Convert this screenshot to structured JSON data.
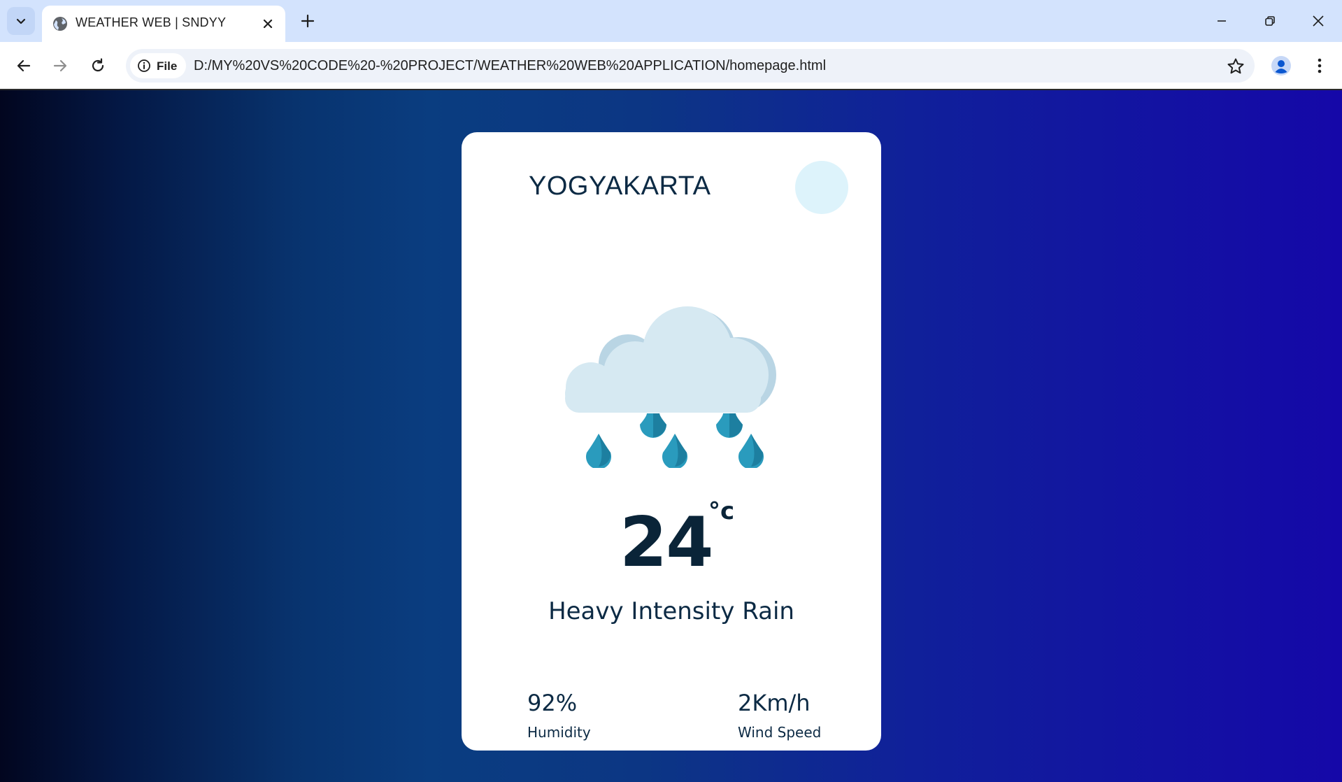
{
  "browser": {
    "tab_title": "WEATHER WEB | SNDYY",
    "site_chip_label": "File",
    "url": "D:/MY%20VS%20CODE%20-%20PROJECT/WEATHER%20WEB%20APPLICATION/homepage.html"
  },
  "weather": {
    "city": "YOGYAKARTA",
    "temperature": "24",
    "unit": "°c",
    "condition": "Heavy Intensity Rain",
    "icon": "heavy-rain-cloud-icon",
    "humidity": {
      "value": "92%",
      "label": "Humidity"
    },
    "wind": {
      "value": "2Km/h",
      "label": "Wind Speed"
    }
  },
  "colors": {
    "card_background": "#ffffff",
    "text_primary": "#0c2a44",
    "cloud": "#d6e9f2",
    "rain_drop": "#2a9bbd",
    "search_circle": "#ddf3fb"
  }
}
